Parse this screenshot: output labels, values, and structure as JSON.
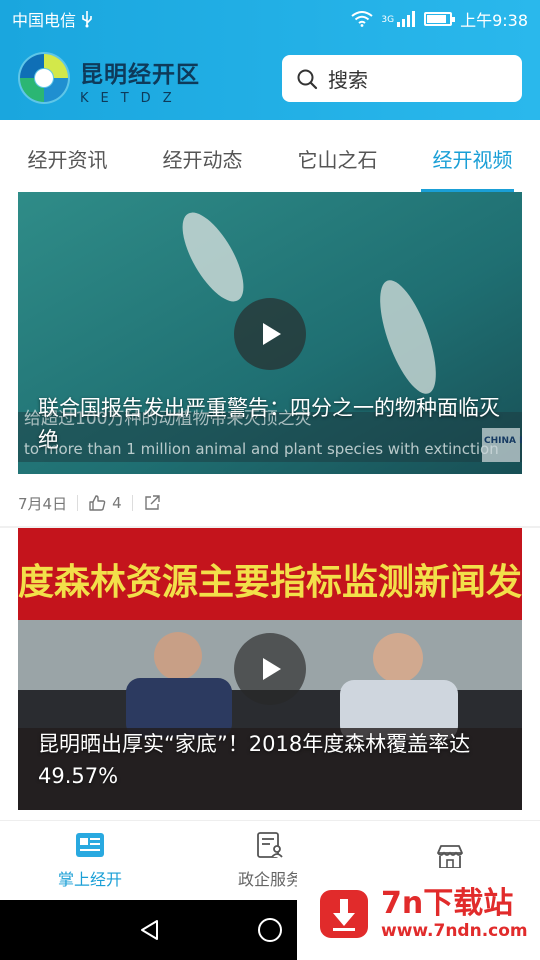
{
  "status_bar": {
    "carrier": "中国电信",
    "network": "3G",
    "time": "上午9:38",
    "battery_level": 0.85
  },
  "header": {
    "brand_name": "昆明经开区",
    "brand_sub": "KETDZ",
    "search_placeholder": "搜索"
  },
  "tabs": [
    {
      "label": "经开资讯",
      "active": false
    },
    {
      "label": "经开动态",
      "active": false
    },
    {
      "label": "它山之石",
      "active": false
    },
    {
      "label": "经开视频",
      "active": true
    }
  ],
  "videos": [
    {
      "title": "联合国报告发出严重警告：四分之一的物种面临灭绝",
      "overlay_caption_cn": "给超过100万种的动植物带来灭顶之灾",
      "overlay_caption_en": "to more than 1 million animal and plant species with extinction",
      "overlay_logo": "CHINA DAILY",
      "date": "7月4日",
      "likes": "4"
    },
    {
      "title": "昆明晒出厚实“家底”！2018年度森林覆盖率达49.57%",
      "banner_text": "度森林资源主要指标监测新闻发布"
    }
  ],
  "bottom_nav": [
    {
      "label": "掌上经开",
      "icon": "news-icon",
      "active": true
    },
    {
      "label": "政企服务",
      "icon": "service-icon",
      "active": false
    },
    {
      "label": "",
      "icon": "store-icon",
      "active": false
    }
  ],
  "watermark": {
    "name": "7n下载站",
    "url": "www.7ndn.com"
  },
  "colors": {
    "accent": "#1a9fd6",
    "header": "#21b0e6",
    "watermark": "#e12b2b"
  }
}
